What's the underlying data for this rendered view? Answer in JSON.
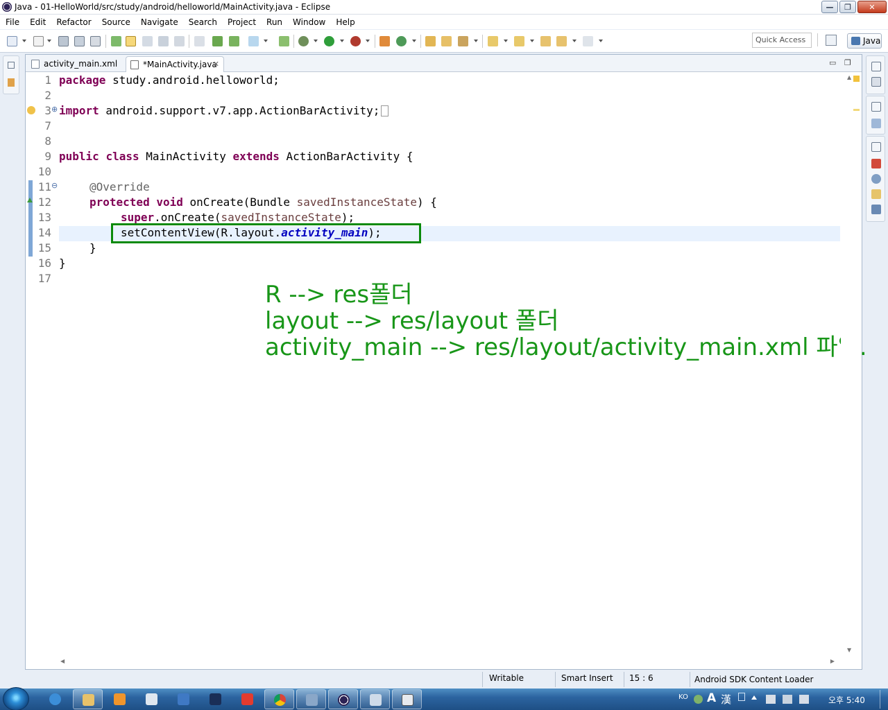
{
  "window": {
    "title": "Java - 01-HelloWorld/src/study/android/helloworld/MainActivity.java - Eclipse",
    "min_glyph": "—",
    "max_glyph": "❐",
    "close_glyph": "✕"
  },
  "menu": [
    "File",
    "Edit",
    "Refactor",
    "Source",
    "Navigate",
    "Search",
    "Project",
    "Run",
    "Window",
    "Help"
  ],
  "toolbar": {
    "quick_access_placeholder": "Quick Access",
    "perspective_label": "Java"
  },
  "tabs": [
    {
      "label": "activity_main.xml",
      "active": false
    },
    {
      "label": "*MainActivity.java",
      "active": true,
      "close_glyph": "✕"
    }
  ],
  "editor_controls": {
    "minimize": "▭",
    "maximize": "❐"
  },
  "line_numbers": [
    "1",
    "2",
    "3",
    "7",
    "8",
    "9",
    "10",
    "11",
    "12",
    "13",
    "14",
    "15",
    "16",
    "17"
  ],
  "fold_markers": {
    "import": "⊕",
    "override": "⊖"
  },
  "code": {
    "l1_kw": "package",
    "l1_rest": " study.android.helloworld;",
    "l3_kw": "import",
    "l3_rest": " android.support.v7.app.ActionBarActivity;",
    "l9_kw1": "public",
    "l9_kw2": "class",
    "l9_name": " MainActivity ",
    "l9_kw3": "extends",
    "l9_rest": " ActionBarActivity {",
    "l11_ann": "@Override",
    "l12_kw1": "protected",
    "l12_kw2": "void",
    "l12_mid": " onCreate(Bundle ",
    "l12_param": "savedInstanceState",
    "l12_end": ") {",
    "l13_kw": "super",
    "l13_mid": ".onCreate(",
    "l13_param": "savedInstanceState",
    "l13_end": ");",
    "l14_start": "setContentView(R.layout.",
    "l14_field": "activity_main",
    "l14_end": ");",
    "l15": "}",
    "l16": "}"
  },
  "annotation_lines": [
    "R --> res폴더",
    "layout --> res/layout 폴더",
    "activity_main --> res/layout/activity_main.xml 파일."
  ],
  "status": {
    "writable": "Writable",
    "insert_mode": "Smart Insert",
    "position": "15 : 6",
    "progress": "Android SDK Content Loader"
  },
  "tray": {
    "lang": "KO",
    "ime_a": "A",
    "ime_han": "漢",
    "clock": "오후 5:40"
  },
  "colors": {
    "keyword": "#7f0055",
    "annotation_text": "#189618",
    "highlight_box": "#0a8a0a"
  }
}
